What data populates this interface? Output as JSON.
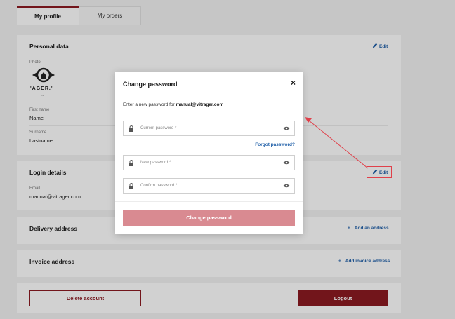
{
  "tabs": {
    "profile": "My profile",
    "orders": "My orders"
  },
  "personal": {
    "title": "Personal data",
    "edit": "Edit",
    "photo_label": "Photo",
    "logo_text": "'AGER.'",
    "first_name_label": "First name",
    "first_name": "Name",
    "surname_label": "Surname",
    "surname": "Lastname"
  },
  "login": {
    "title": "Login details",
    "edit": "Edit",
    "email_label": "Email",
    "email": "manual@vitrager.com"
  },
  "delivery": {
    "title": "Delivery address",
    "add": "Add an address"
  },
  "invoice": {
    "title": "Invoice address",
    "add": "Add invoice address"
  },
  "actions": {
    "delete": "Delete account",
    "logout": "Logout"
  },
  "modal": {
    "title": "Change password",
    "close": "×",
    "desc_prefix": "Enter a new password for ",
    "desc_email": "manual@vitrager.com",
    "current_placeholder": "Current password *",
    "forgot": "Forgot password?",
    "new_placeholder": "New password *",
    "confirm_placeholder": "Confirm password *",
    "submit": "Change password"
  },
  "colors": {
    "brand": "#8b1a22",
    "link": "#1f5fa8",
    "submit_disabled": "#d98a91",
    "annotation": "#e0404a"
  },
  "icons": [
    "pencil-icon",
    "plus-icon",
    "lock-icon",
    "eye-icon",
    "close-icon",
    "logo-emblem-icon"
  ]
}
